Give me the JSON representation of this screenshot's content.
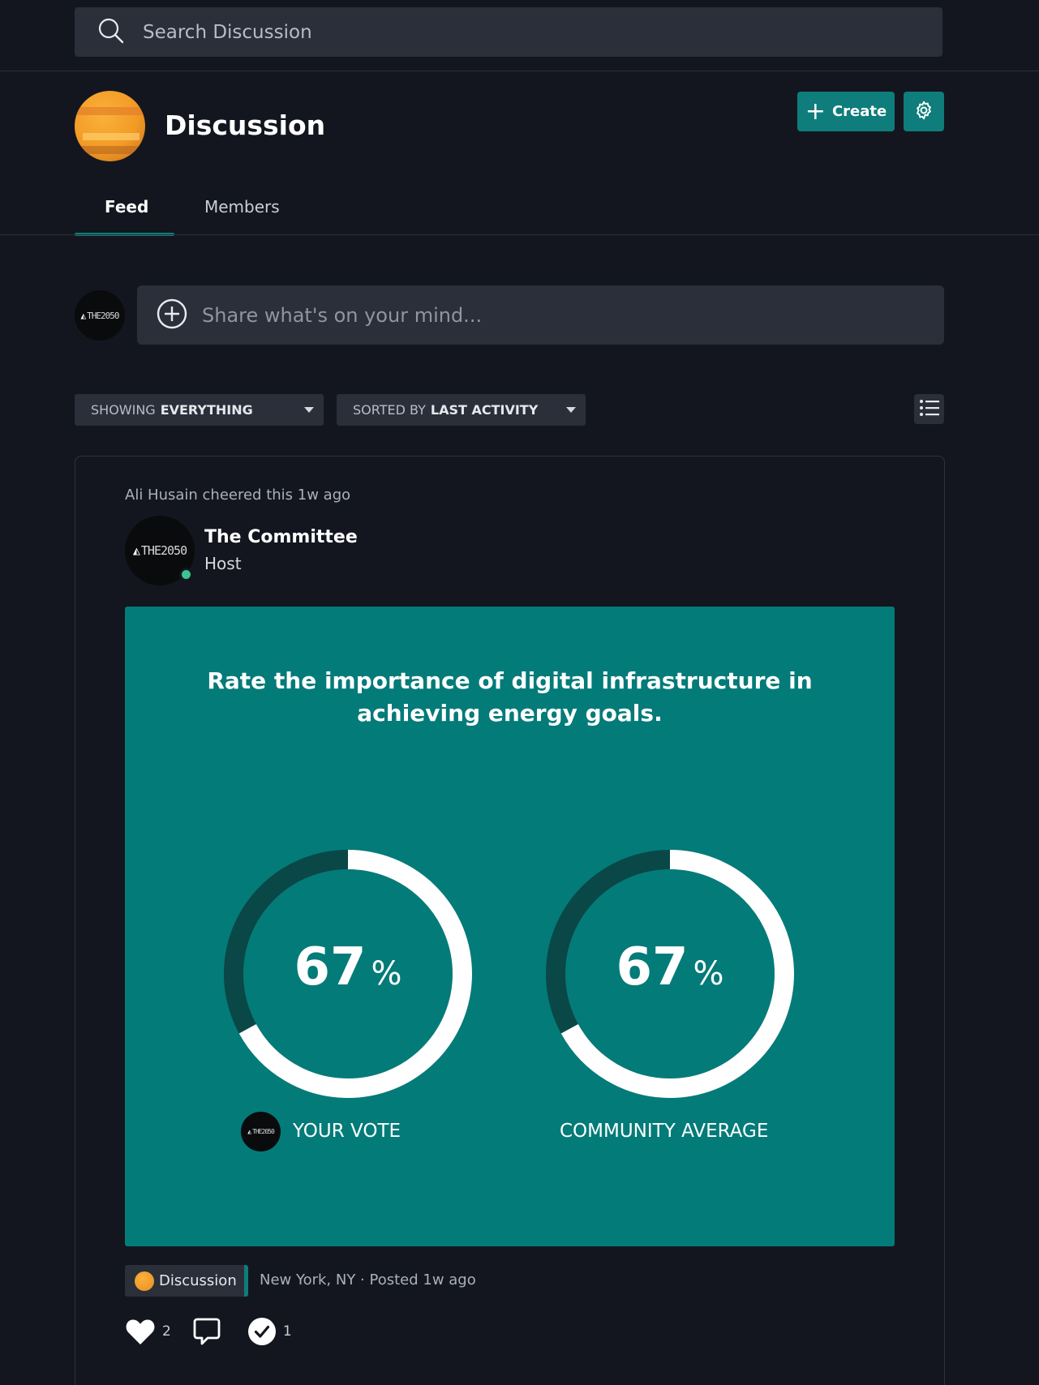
{
  "search": {
    "placeholder": "Search Discussion"
  },
  "header": {
    "title": "Discussion",
    "create_label": "Create"
  },
  "tabs": [
    {
      "label": "Feed",
      "active": true
    },
    {
      "label": "Members",
      "active": false
    }
  ],
  "logo_text": "THE2050",
  "composer": {
    "placeholder": "Share what's on your mind..."
  },
  "filters": {
    "show_prefix": "SHOWING",
    "show_value": "EVERYTHING",
    "sort_prefix": "SORTED BY",
    "sort_value": "LAST ACTIVITY"
  },
  "post": {
    "activity": "Ali Husain cheered this 1w ago",
    "author_name": "The Committee",
    "author_role": "Host",
    "poll": {
      "question": "Rate the importance of digital infrastructure in achieving energy goals.",
      "your_vote": {
        "value": 67,
        "display": "67",
        "unit": "%",
        "label": "YOUR VOTE"
      },
      "community": {
        "value": 67,
        "display": "67",
        "unit": "%",
        "label": "COMMUNITY AVERAGE"
      }
    },
    "topic": "Discussion",
    "meta": "New York, NY ·  Posted 1w ago",
    "likes": "2",
    "checks": "1"
  },
  "colors": {
    "background": "#13161f",
    "surface": "#2a2f3a",
    "accent": "#0e7d7b",
    "poll_bg": "#037b79",
    "ring_track": "#0a4747",
    "ring_fill": "#ffffff",
    "online": "#3ec48f"
  },
  "icons": [
    "search-icon",
    "plus-icon",
    "gear-icon",
    "plus-circle-icon",
    "chevron-down-icon",
    "list-icon",
    "heart-icon",
    "comment-icon",
    "check-circle-icon"
  ]
}
